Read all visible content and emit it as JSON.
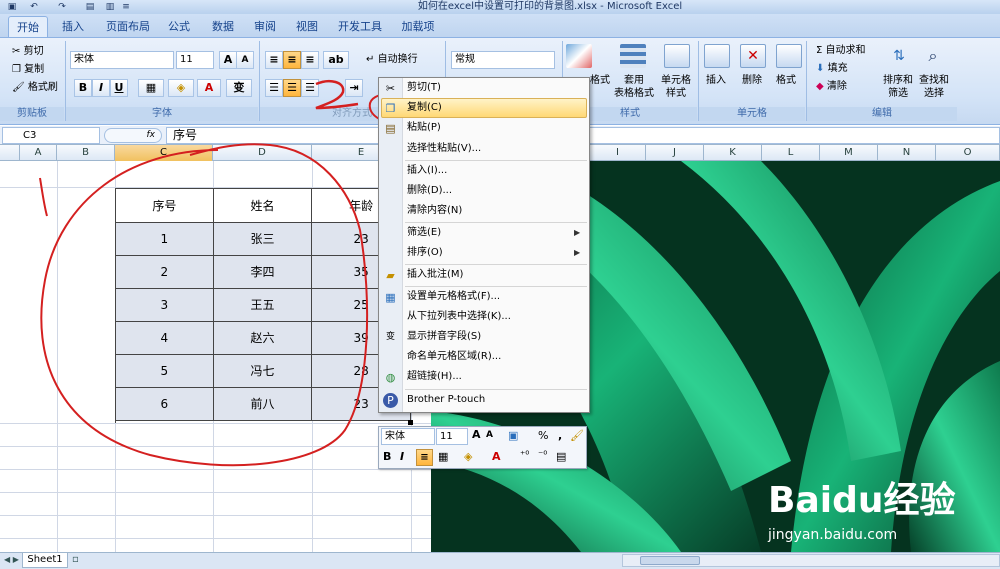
{
  "window": {
    "title": "如何在excel中设置可打印的背景图.xlsx - Microsoft Excel"
  },
  "tabs": [
    "开始",
    "插入",
    "页面布局",
    "公式",
    "数据",
    "审阅",
    "视图",
    "开发工具",
    "加载项"
  ],
  "clipboard": {
    "cut": "剪切",
    "copy": "复制",
    "painter": "格式刷",
    "group": "剪贴板"
  },
  "font": {
    "name": "宋体",
    "size": "11",
    "group": "字体",
    "bold": "B",
    "italic": "I",
    "underline": "U",
    "color_label": "A",
    "grow": "A",
    "shrink": "A"
  },
  "alignment": {
    "wrap": "自动换行",
    "group": "对齐方式"
  },
  "number": {
    "format": "常规"
  },
  "styles": {
    "cond_partial": "格式",
    "table": "套用\n表格格式",
    "cell": "单元格\n样式",
    "group": "样式"
  },
  "cells": {
    "insert": "插入",
    "delete": "删除",
    "format": "格式",
    "group": "单元格"
  },
  "editing": {
    "autosum": "自动求和",
    "fill": "填充",
    "clear": "清除",
    "sort": "排序和\n筛选",
    "find": "查找和\n选择",
    "group": "编辑"
  },
  "formula_bar": {
    "name_box": "C3",
    "fx": "fx",
    "content": "序号"
  },
  "columns": [
    "A",
    "B",
    "C",
    "D",
    "E",
    "I",
    "J",
    "K",
    "L",
    "M",
    "N",
    "O"
  ],
  "table": {
    "headers": [
      "序号",
      "姓名",
      "年龄"
    ],
    "rows": [
      [
        "1",
        "张三",
        "23"
      ],
      [
        "2",
        "李四",
        "35"
      ],
      [
        "3",
        "王五",
        "25"
      ],
      [
        "4",
        "赵六",
        "39"
      ],
      [
        "5",
        "冯七",
        "28"
      ],
      [
        "6",
        "前八",
        "23"
      ]
    ]
  },
  "context_menu": [
    {
      "label": "剪切(T)",
      "icon": "scissors-icon",
      "name": "menu-cut"
    },
    {
      "label": "复制(C)",
      "icon": "copy-icon",
      "name": "menu-copy",
      "highlight": true
    },
    {
      "label": "粘贴(P)",
      "icon": "paste-icon",
      "name": "menu-paste"
    },
    {
      "label": "选择性粘贴(V)...",
      "name": "menu-paste-special"
    },
    {
      "label": "插入(I)...",
      "name": "menu-insert"
    },
    {
      "label": "删除(D)...",
      "name": "menu-delete"
    },
    {
      "label": "清除内容(N)",
      "name": "menu-clear-contents"
    },
    {
      "label": "筛选(E)",
      "name": "menu-filter",
      "submenu": true
    },
    {
      "label": "排序(O)",
      "name": "menu-sort",
      "submenu": true
    },
    {
      "label": "插入批注(M)",
      "icon": "comment-icon",
      "name": "menu-insert-comment"
    },
    {
      "label": "设置单元格格式(F)...",
      "icon": "format-cells-icon",
      "name": "menu-format-cells"
    },
    {
      "label": "从下拉列表中选择(K)...",
      "name": "menu-pick-list"
    },
    {
      "label": "显示拼音字段(S)",
      "icon": "phonetic-icon",
      "name": "menu-phonetic"
    },
    {
      "label": "命名单元格区域(R)...",
      "name": "menu-name-range"
    },
    {
      "label": "超链接(H)...",
      "icon": "hyperlink-icon",
      "name": "menu-hyperlink"
    },
    {
      "label": "Brother P-touch",
      "icon": "ptouch-icon",
      "name": "menu-ptouch"
    }
  ],
  "mini_toolbar": {
    "font": "宋体",
    "size": "11",
    "percent": "%",
    "comma": ",",
    "bold": "B",
    "italic": "I"
  },
  "sheets": [
    "Sheet1"
  ],
  "watermark": {
    "brand": "Baidu经验",
    "url": "jingyan.baidu.com"
  },
  "annotation": {
    "number": "2"
  },
  "colors": {
    "accent": "#15428b",
    "ribbon": "#d3e3f7",
    "annotation": "#d42020",
    "menu_highlight": "#ffd875",
    "leaf": "#0f8f5a"
  }
}
